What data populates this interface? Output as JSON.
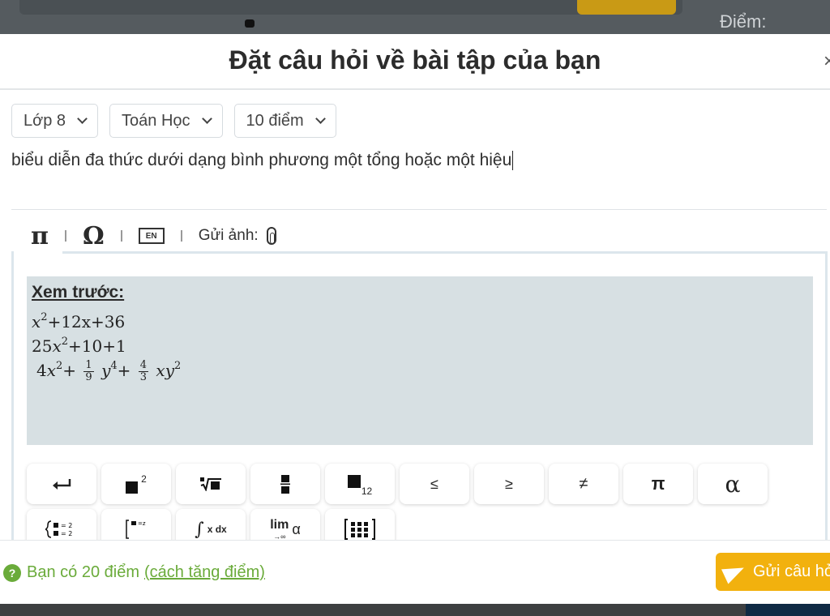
{
  "background": {
    "partial_text": "Điểm:"
  },
  "modal": {
    "title": "Đặt câu hỏi về bài tập của bạn",
    "close_icon": "×"
  },
  "selects": {
    "grade": "Lớp 8",
    "subject": "Toán Học",
    "points": "10 điểm"
  },
  "question": {
    "text": "biểu diễn đa thức dưới dạng bình phương một tổng hoặc một hiệu"
  },
  "toolbar": {
    "pi_icon": "π",
    "omega_icon": "Ω",
    "en_label": "EN",
    "send_image_label": "Gửi ảnh:"
  },
  "preview": {
    "label": "Xem trước:",
    "line1": {
      "var": "x",
      "exp": "2",
      "rest": "+12x+36"
    },
    "line2": {
      "coef": "25",
      "var": "x",
      "exp": "2",
      "rest": "+10+1"
    },
    "line3": {
      "coef": "4",
      "var1": "x",
      "exp1": "2",
      "plus1": "+",
      "frac1_num": "1",
      "frac1_den": "9",
      "var2": "y",
      "exp2": "4",
      "plus2": "+",
      "frac2_num": "4",
      "frac2_den": "3",
      "var3": "xy",
      "exp3": "2"
    }
  },
  "keypad": {
    "row1": [
      "↵",
      "■²",
      "√■",
      "■/■",
      "■₁₂",
      "≤",
      "≥",
      "≠",
      "π",
      "α"
    ],
    "row2": [
      "{■=2 ■=2",
      "[■=z",
      "∫ x dx",
      "lim α",
      "⁞⁞⁞"
    ],
    "lim_label": "lim",
    "lim_sub": "→∞",
    "integral_label": "x dx",
    "square_exp": "2",
    "subscript": "12"
  },
  "footer": {
    "points_text": "Bạn có 20 điểm",
    "points_link": "(cách tăng điểm)",
    "help_icon": "?",
    "send_label": "Gửi câu hỏi"
  },
  "colors": {
    "accent_yellow": "#f2b10e",
    "green": "#6aab3a",
    "preview_bg": "#d7e0e3"
  }
}
